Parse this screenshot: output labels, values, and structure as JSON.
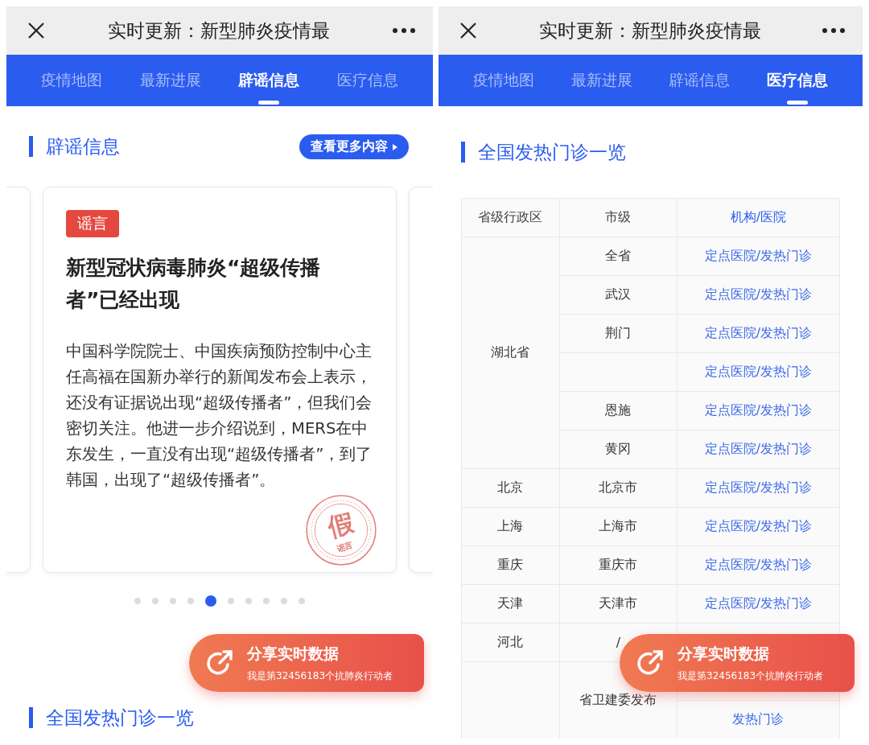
{
  "panels": [
    {
      "title": "实时更新：新型肺炎疫情最",
      "tabs": [
        {
          "label": "疫情地图",
          "selected": false
        },
        {
          "label": "最新进展",
          "selected": false
        },
        {
          "label": "辟谣信息",
          "selected": true
        },
        {
          "label": "医疗信息",
          "selected": false
        }
      ],
      "kind": "rumors",
      "section": "辟谣信息",
      "more": "查看更多内容",
      "card": {
        "tag": "谣言",
        "headline": "新型冠状病毒肺炎“超级传播者”已经出现",
        "body": "中国科学院院士、中国疾病预防控制中心主任高福在国新办举行的新闻发布会上表示，还没有证据说出现“超级传播者”，但我们会密切关注。他进一步介绍说到，MERS在中东发生，一直没有出现“超级传播者”，到了韩国，出现了“超级传播者”。",
        "stamp": {
          "big": "假",
          "small": "谣言"
        }
      },
      "dots": [
        {
          "selected": false
        },
        {
          "selected": false
        },
        {
          "selected": false
        },
        {
          "selected": false
        },
        {
          "selected": true
        },
        {
          "selected": false
        },
        {
          "selected": false
        },
        {
          "selected": false
        },
        {
          "selected": false
        },
        {
          "selected": false
        }
      ],
      "share": {
        "title": "分享实时数据",
        "subtitle": "我是第32456183个抗肺炎行动者"
      },
      "next_section": "全国发热门诊一览"
    },
    {
      "title": "实时更新：新型肺炎疫情最",
      "tabs": [
        {
          "label": "疫情地图",
          "selected": false
        },
        {
          "label": "最新进展",
          "selected": false
        },
        {
          "label": "辟谣信息",
          "selected": false
        },
        {
          "label": "医疗信息",
          "selected": true
        }
      ],
      "kind": "clinics",
      "section": "全国发热门诊一览",
      "table": {
        "columns": [
          "省级行政区",
          "市级",
          "机构/医院"
        ],
        "groups": [
          {
            "province": "湖北省",
            "entries": [
              {
                "city": "全省",
                "links": [
                  "定点医院/发热门诊"
                ]
              },
              {
                "city": "武汉",
                "links": [
                  "定点医院/发热门诊"
                ]
              },
              {
                "city": "荆门",
                "links": [
                  "定点医院/发热门诊"
                ]
              },
              {
                "links": [
                  "定点医院/发热门诊"
                ]
              },
              {
                "city": "恩施",
                "links": [
                  "定点医院/发热门诊"
                ]
              },
              {
                "city": "黄冈",
                "links": [
                  "定点医院/发热门诊"
                ]
              }
            ]
          },
          {
            "province": "北京",
            "entries": [
              {
                "city": "北京市",
                "links": [
                  "定点医院/发热门诊"
                ]
              }
            ]
          },
          {
            "province": "上海",
            "entries": [
              {
                "city": "上海市",
                "links": [
                  "定点医院/发热门诊"
                ]
              }
            ]
          },
          {
            "province": "重庆",
            "entries": [
              {
                "city": "重庆市",
                "links": [
                  "定点医院/发热门诊"
                ]
              }
            ]
          },
          {
            "province": "天津",
            "entries": [
              {
                "city": "天津市",
                "links": [
                  "定点医院/发热门诊"
                ]
              }
            ]
          },
          {
            "province": "河北",
            "entries": [
              {
                "city": "/"
              }
            ]
          },
          {
            "entries": [
              {
                "city": "省卫建委发布",
                "links": [
                  "发热门诊"
                ],
                "covered_above": true
              }
            ]
          }
        ]
      },
      "share": {
        "title": "分享实时数据",
        "subtitle": "我是第32456183个抗肺炎行动者"
      }
    }
  ]
}
